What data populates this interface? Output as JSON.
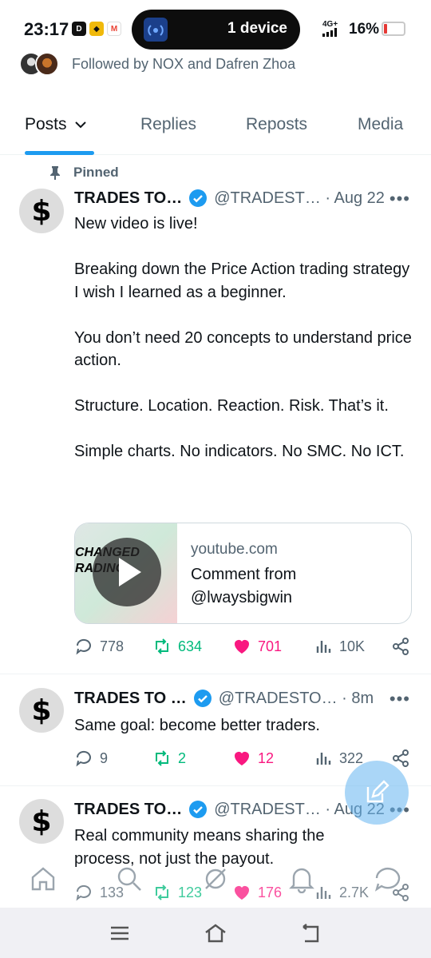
{
  "status": {
    "time": "23:17",
    "island_text": "1 device",
    "network": "4G+",
    "battery": "16%"
  },
  "followed": {
    "text": "Followed by NOX and Dafren Zhoa"
  },
  "tabs": [
    {
      "label": "Posts"
    },
    {
      "label": "Replies"
    },
    {
      "label": "Reposts"
    },
    {
      "label": "Media"
    }
  ],
  "pinned_label": "Pinned",
  "posts": [
    {
      "name": "TRADES TO…",
      "handle": "@TRADEST… · Aug 22",
      "text": "New video is live!\n\nBreaking down the Price Action trading strategy I wish I learned as a beginner.\n\nYou don’t need 20 concepts to understand price action.\n\nStructure. Location. Reaction. Risk. That’s it.\n\nSimple charts. No indicators. No SMC. No ICT.",
      "card": {
        "thumb_line1": "CHANGED",
        "thumb_line2": "RADING",
        "domain": "youtube.com",
        "title": "Comment from\n@lwaysbigwin"
      },
      "replies": "778",
      "reposts": "634",
      "likes": "701",
      "views": "10K"
    },
    {
      "name": "TRADES TO …",
      "handle": "@TRADESTO… · 8m",
      "text": "Same goal: become better traders.",
      "replies": "9",
      "reposts": "2",
      "likes": "12",
      "views": "322"
    },
    {
      "name": "TRADES TO…",
      "handle": "@TRADEST… · Aug 22",
      "text": "Real community means sharing the\nprocess, not just the payout.",
      "replies": "133",
      "reposts": "123",
      "likes": "176",
      "views": "2.7K"
    }
  ],
  "colors": {
    "accent": "#1d9bf0",
    "repost": "#00ba7c",
    "like": "#f91880",
    "muted": "#536471"
  }
}
